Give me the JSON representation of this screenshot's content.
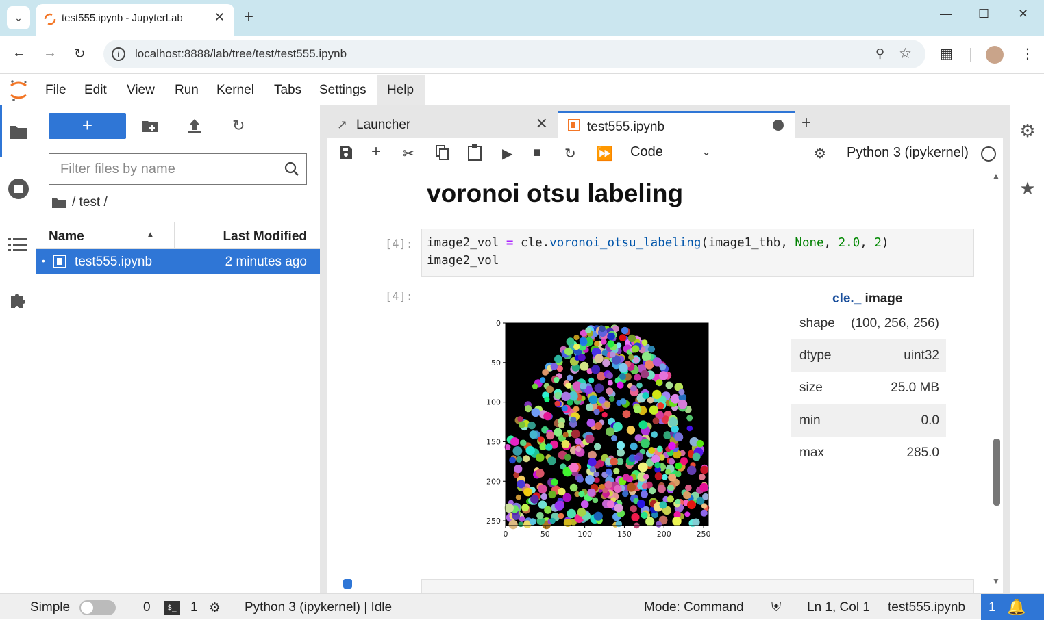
{
  "browser": {
    "tab_title": "test555.ipynb - JupyterLab",
    "url": "localhost:8888/lab/tree/test/test555.ipynb"
  },
  "menu": {
    "items": [
      "File",
      "Edit",
      "View",
      "Run",
      "Kernel",
      "Tabs",
      "Settings",
      "Help"
    ]
  },
  "filebrowser": {
    "new_label": "+",
    "filter_placeholder": "Filter files by name",
    "breadcrumb": "/ test /",
    "col_name": "Name",
    "col_modified": "Last Modified",
    "files": [
      {
        "name": "test555.ipynb",
        "modified": "2 minutes ago"
      }
    ]
  },
  "dock": {
    "tabs": [
      {
        "label": "Launcher"
      },
      {
        "label": "test555.ipynb"
      }
    ],
    "cell_type": "Code",
    "kernel": "Python 3 (ipykernel)"
  },
  "notebook": {
    "heading": "voronoi otsu labeling",
    "in_prompt": "[4]:",
    "out_prompt": "[4]:",
    "code": {
      "var": "image2_vol",
      "op": "=",
      "obj": "cle.",
      "fn": "voronoi_otsu_labeling",
      "arg1": "image1_thb",
      "kw": "None",
      "n1": "2.0",
      "n2": "2",
      "line2": "image2_vol"
    },
    "output_info": {
      "title_prefix": "cle._",
      "title_suffix": " image",
      "rows": [
        {
          "key": "shape",
          "value": "(100, 256, 256)"
        },
        {
          "key": "dtype",
          "value": "uint32"
        },
        {
          "key": "size",
          "value": "25.0 MB"
        },
        {
          "key": "min",
          "value": "0.0"
        },
        {
          "key": "max",
          "value": "285.0"
        }
      ]
    },
    "plot": {
      "x_ticks": [
        "0",
        "50",
        "100",
        "150",
        "200",
        "250"
      ],
      "y_ticks": [
        "0",
        "50",
        "100",
        "150",
        "200",
        "250"
      ]
    }
  },
  "statusbar": {
    "mode_label": "Simple",
    "terminals": "0",
    "kernels": "1",
    "kernel_status": "Python 3 (ipykernel) | Idle",
    "mode": "Mode: Command",
    "cursor": "Ln 1, Col 1",
    "file": "test555.ipynb",
    "notifications": "1"
  },
  "colors": {
    "accent": "#2f76d6",
    "tabstrip": "#cbe6ef"
  }
}
